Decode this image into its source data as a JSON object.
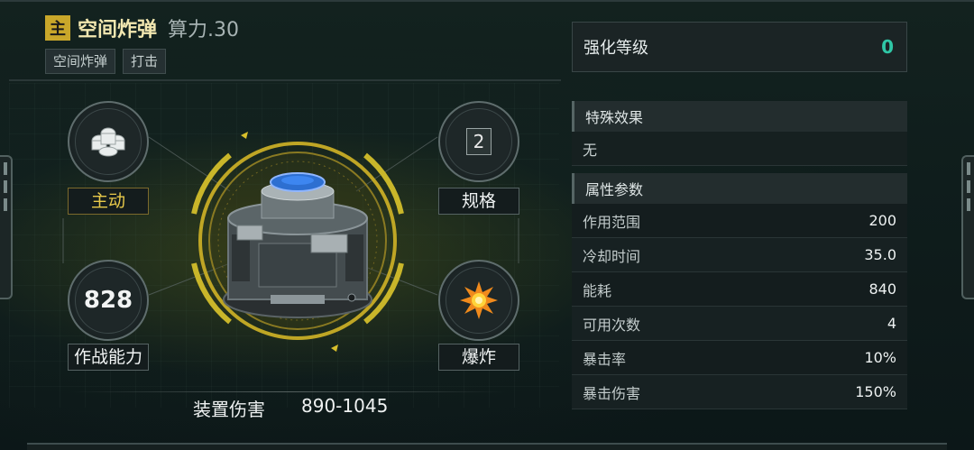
{
  "header": {
    "badge": "主",
    "title": "空间炸弹",
    "power": "算力.30",
    "tags": [
      "空间炸弹",
      "打击"
    ]
  },
  "enhance": {
    "label": "强化等级",
    "value": "0"
  },
  "special": {
    "title": "特殊效果",
    "value": "无"
  },
  "attributes": {
    "title": "属性参数",
    "rows": [
      {
        "key": "作用范围",
        "value": "200"
      },
      {
        "key": "冷却时间",
        "value": "35.0"
      },
      {
        "key": "能耗",
        "value": "840"
      },
      {
        "key": "可用次数",
        "value": "4"
      },
      {
        "key": "暴击率",
        "value": "10%"
      },
      {
        "key": "暴击伤害",
        "value": "150%"
      }
    ]
  },
  "nodes": {
    "type": {
      "label": "主动",
      "icon": "bombs-icon"
    },
    "spec": {
      "label": "规格",
      "value": "2"
    },
    "combat": {
      "label": "作战能力",
      "value": "828"
    },
    "effect": {
      "label": "爆炸",
      "icon": "explosion-icon"
    }
  },
  "damage": {
    "label": "装置伤害",
    "value": "890-1045"
  },
  "colors": {
    "accent": "#c9a72a",
    "enhance": "#2fc7a6",
    "active_label": "#e8c94a"
  }
}
